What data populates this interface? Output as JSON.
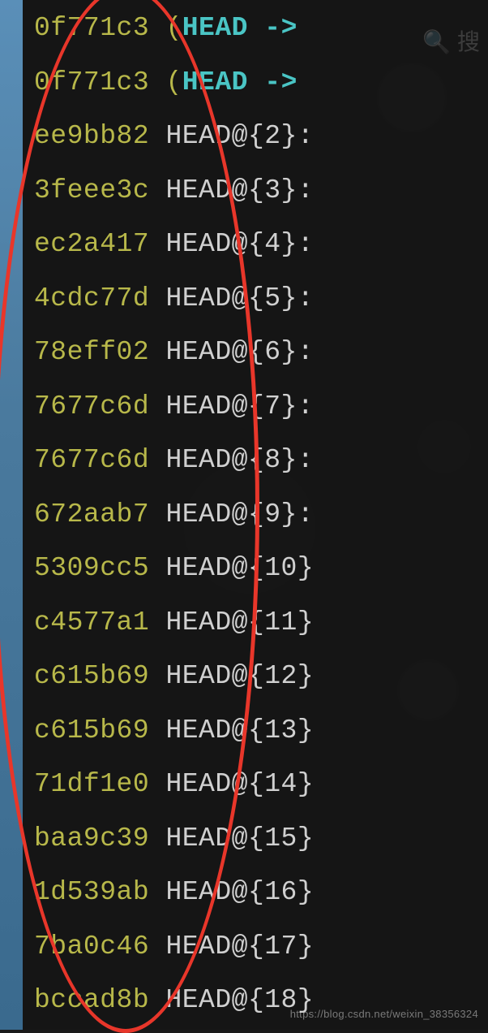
{
  "reflog": {
    "head_lines": [
      {
        "hash": "0f771c3",
        "ref": "HEAD",
        "arrow": "->"
      },
      {
        "hash": "0f771c3",
        "ref": "HEAD",
        "arrow": "->"
      }
    ],
    "entries": [
      {
        "hash": "ee9bb82",
        "ref": "HEAD@{2}:"
      },
      {
        "hash": "3feee3c",
        "ref": "HEAD@{3}:"
      },
      {
        "hash": "ec2a417",
        "ref": "HEAD@{4}:"
      },
      {
        "hash": "4cdc77d",
        "ref": "HEAD@{5}:"
      },
      {
        "hash": "78eff02",
        "ref": "HEAD@{6}:"
      },
      {
        "hash": "7677c6d",
        "ref": "HEAD@{7}:"
      },
      {
        "hash": "7677c6d",
        "ref": "HEAD@{8}:"
      },
      {
        "hash": "672aab7",
        "ref": "HEAD@{9}:"
      },
      {
        "hash": "5309cc5",
        "ref": "HEAD@{10}"
      },
      {
        "hash": "c4577a1",
        "ref": "HEAD@{11}"
      },
      {
        "hash": "c615b69",
        "ref": "HEAD@{12}"
      },
      {
        "hash": "c615b69",
        "ref": "HEAD@{13}"
      },
      {
        "hash": "71df1e0",
        "ref": "HEAD@{14}"
      },
      {
        "hash": "baa9c39",
        "ref": "HEAD@{15}"
      },
      {
        "hash": "1d539ab",
        "ref": "HEAD@{16}"
      },
      {
        "hash": "7ba0c46",
        "ref": "HEAD@{17}"
      },
      {
        "hash": "bccad8b",
        "ref": "HEAD@{18}"
      }
    ],
    "paren_open": "(",
    "paren_close": ")"
  },
  "search_hint": "搜",
  "watermark": "https://blog.csdn.net/weixin_38356324",
  "colors": {
    "hash": "#b8b84a",
    "head_keyword": "#4ac5c5",
    "ref_text": "#d0d0d0",
    "annotation": "#e8362a",
    "terminal_bg": "rgba(20,20,20,0.88)"
  }
}
